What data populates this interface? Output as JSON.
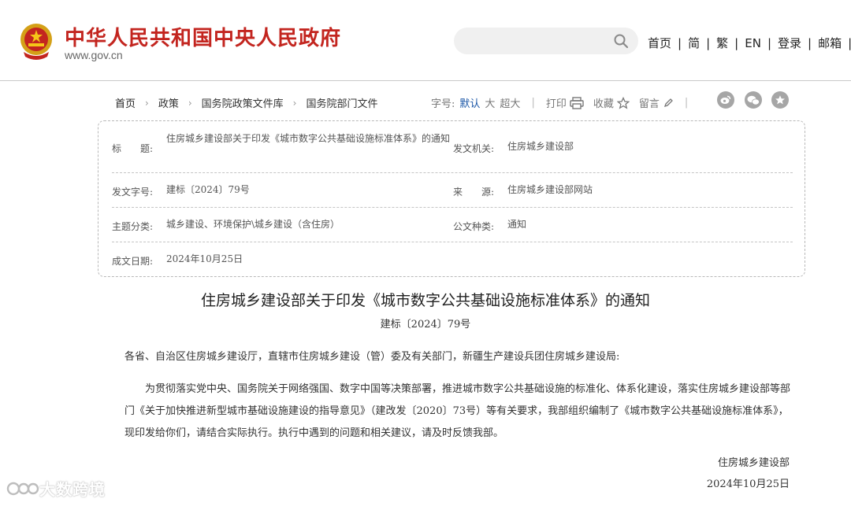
{
  "header": {
    "site_title": "中华人民共和国中央人民政府",
    "site_domain": "www.gov.cn",
    "search": {
      "placeholder": ""
    },
    "nav": [
      {
        "label": "首页"
      },
      {
        "label": "简"
      },
      {
        "label": "繁"
      },
      {
        "label": "EN"
      },
      {
        "label": "登录"
      },
      {
        "label": "邮箱"
      }
    ]
  },
  "breadcrumb": [
    "首页",
    "政策",
    "国务院政策文件库",
    "国务院部门文件"
  ],
  "tools": {
    "font_size_label": "字号:",
    "font_default": "默认",
    "font_large": "大",
    "font_xlarge": "超大",
    "print": "打印",
    "favorite": "收藏",
    "comment": "留言"
  },
  "info": {
    "title_label": "标　　题:",
    "title_value": "住房城乡建设部关于印发《城市数字公共基础设施标准体系》的通知",
    "issuer_label": "发文机关:",
    "issuer_value": "住房城乡建设部",
    "doc_no_label": "发文字号:",
    "doc_no_value": "建标〔2024〕79号",
    "source_label": "来　　源:",
    "source_value": "住房城乡建设部网站",
    "topic_label": "主题分类:",
    "topic_value": "城乡建设、环境保护\\城乡建设（含住房）",
    "type_label": "公文种类:",
    "type_value": "通知",
    "date_label": "成文日期:",
    "date_value": "2024年10月25日"
  },
  "document": {
    "title": "住房城乡建设部关于印发《城市数字公共基础设施标准体系》的通知",
    "number": "建标〔2024〕79号",
    "salutation": "各省、自治区住房城乡建设厅，直辖市住房城乡建设（管）委及有关部门，新疆生产建设兵团住房城乡建设局:",
    "paragraph": "为贯彻落实党中央、国务院关于网络强国、数字中国等决策部署，推进城市数字公共基础设施的标准化、体系化建设，落实住房城乡建设部等部门《关于加快推进新型城市基础设施建设的指导意见》（建改发〔2020〕73号）等有关要求，我部组织编制了《城市数字公共基础设施标准体系》，现印发给你们，请结合实际执行。执行中遇到的问题和相关建议，请及时反馈我部。",
    "signature": "住房城乡建设部",
    "date": "2024年10月25日"
  },
  "watermark": "大数跨境",
  "colors": {
    "brand_red": "#c3251f",
    "active_blue": "#1a56a6"
  }
}
